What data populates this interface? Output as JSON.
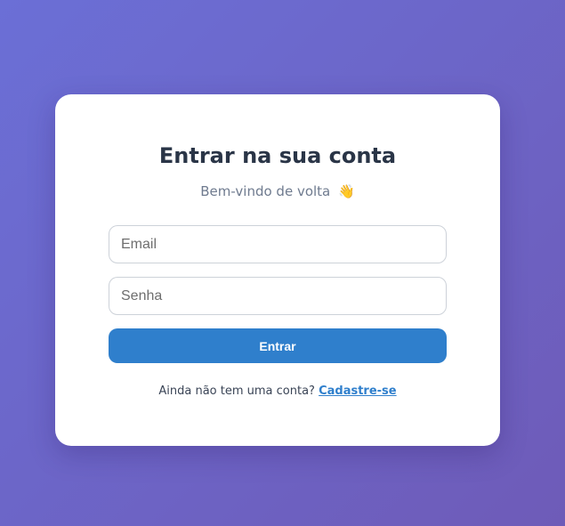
{
  "login": {
    "title": "Entrar na sua conta",
    "subtitle": "Bem-vindo de volta",
    "subtitle_emoji": "👋",
    "email_placeholder": "Email",
    "email_value": "",
    "password_placeholder": "Senha",
    "password_value": "",
    "submit_label": "Entrar",
    "signup_prompt": "Ainda não tem uma conta?",
    "signup_link": "Cadastre-se"
  },
  "colors": {
    "background_start": "#6b6fd6",
    "background_end": "#6e5bb8",
    "card": "#ffffff",
    "primary": "#2f7fcc",
    "title_text": "#2a3547",
    "muted_text": "#6f7b8f"
  },
  "icons": {
    "subtitle_icon": "waving-hand-icon"
  }
}
